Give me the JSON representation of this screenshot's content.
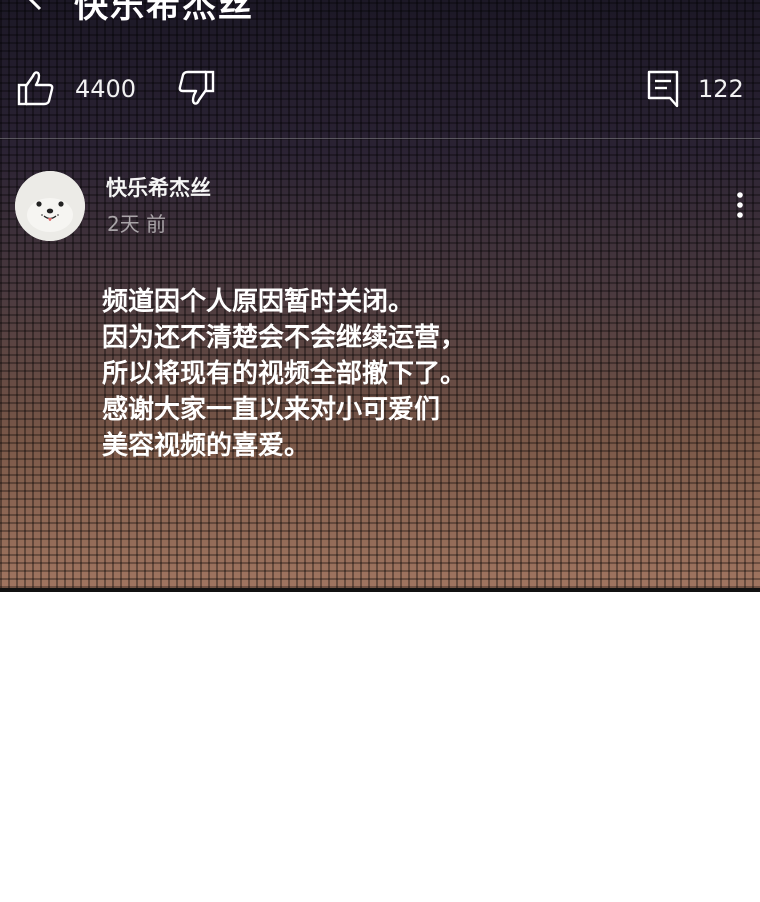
{
  "header": {
    "title": "快乐希杰丝"
  },
  "actions": {
    "like_icon": "thumbs-up-icon",
    "like_count": "4400",
    "dislike_icon": "thumbs-down-icon",
    "comment_icon": "comment-icon",
    "comment_count": "122"
  },
  "post": {
    "author": "快乐希杰丝",
    "time": "2天 前",
    "avatar_icon": "seal-avatar",
    "lines": [
      "频道因个人原因暂时关闭。",
      "因为还不清楚会不会继续运营，",
      "所以将现有的视频全部撤下了。",
      "感谢大家一直以来对小可爱们",
      "美容视频的喜爱。"
    ]
  },
  "colors": {
    "text": "#ffffff",
    "muted": "#a9a4a8",
    "background_top": "#1c1826",
    "background_bottom": "#a07560"
  }
}
